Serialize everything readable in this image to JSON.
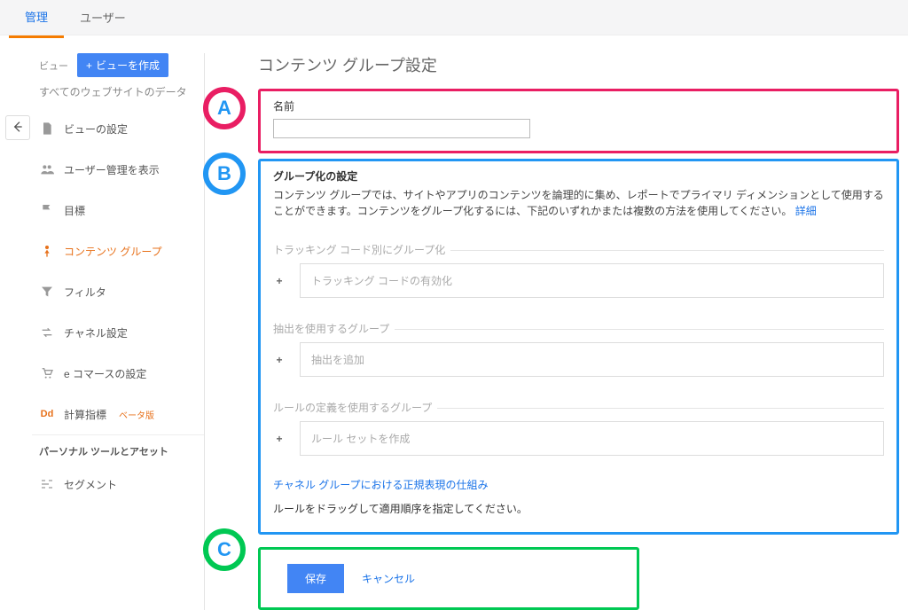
{
  "tabs": {
    "admin": "管理",
    "user": "ユーザー"
  },
  "sidebar": {
    "view_label": "ビュー",
    "create_view": "ビューを作成",
    "data_label": "すべてのウェブサイトのデータ",
    "items": [
      {
        "label": "ビューの設定"
      },
      {
        "label": "ユーザー管理を表示"
      },
      {
        "label": "目標"
      },
      {
        "label": "コンテンツ グループ"
      },
      {
        "label": "フィルタ"
      },
      {
        "label": "チャネル設定"
      },
      {
        "label": "e コマースの設定"
      },
      {
        "label": "計算指標"
      }
    ],
    "beta": "ベータ版",
    "section": "パーソナル ツールとアセット",
    "segment": "セグメント"
  },
  "main": {
    "title": "コンテンツ グループ設定",
    "name_label": "名前",
    "group_heading": "グループ化の設定",
    "group_desc": "コンテンツ グループでは、サイトやアプリのコンテンツを論理的に集め、レポートでプライマリ ディメンションとして使用することができます。コンテンツをグループ化するには、下記のいずれかまたは複数の方法を使用してください。",
    "help_link": "詳細",
    "method1": {
      "legend": "トラッキング コード別にグループ化",
      "box": "トラッキング コードの有効化"
    },
    "method2": {
      "legend": "抽出を使用するグループ",
      "box": "抽出を追加"
    },
    "method3": {
      "legend": "ルールの定義を使用するグループ",
      "box": "ルール セットを作成"
    },
    "regex_link": "チャネル グループにおける正規表現の仕組み",
    "drag_note": "ルールをドラッグして適用順序を指定してください。",
    "save": "保存",
    "cancel": "キャンセル"
  },
  "badges": {
    "A": "A",
    "B": "B",
    "C": "C"
  }
}
